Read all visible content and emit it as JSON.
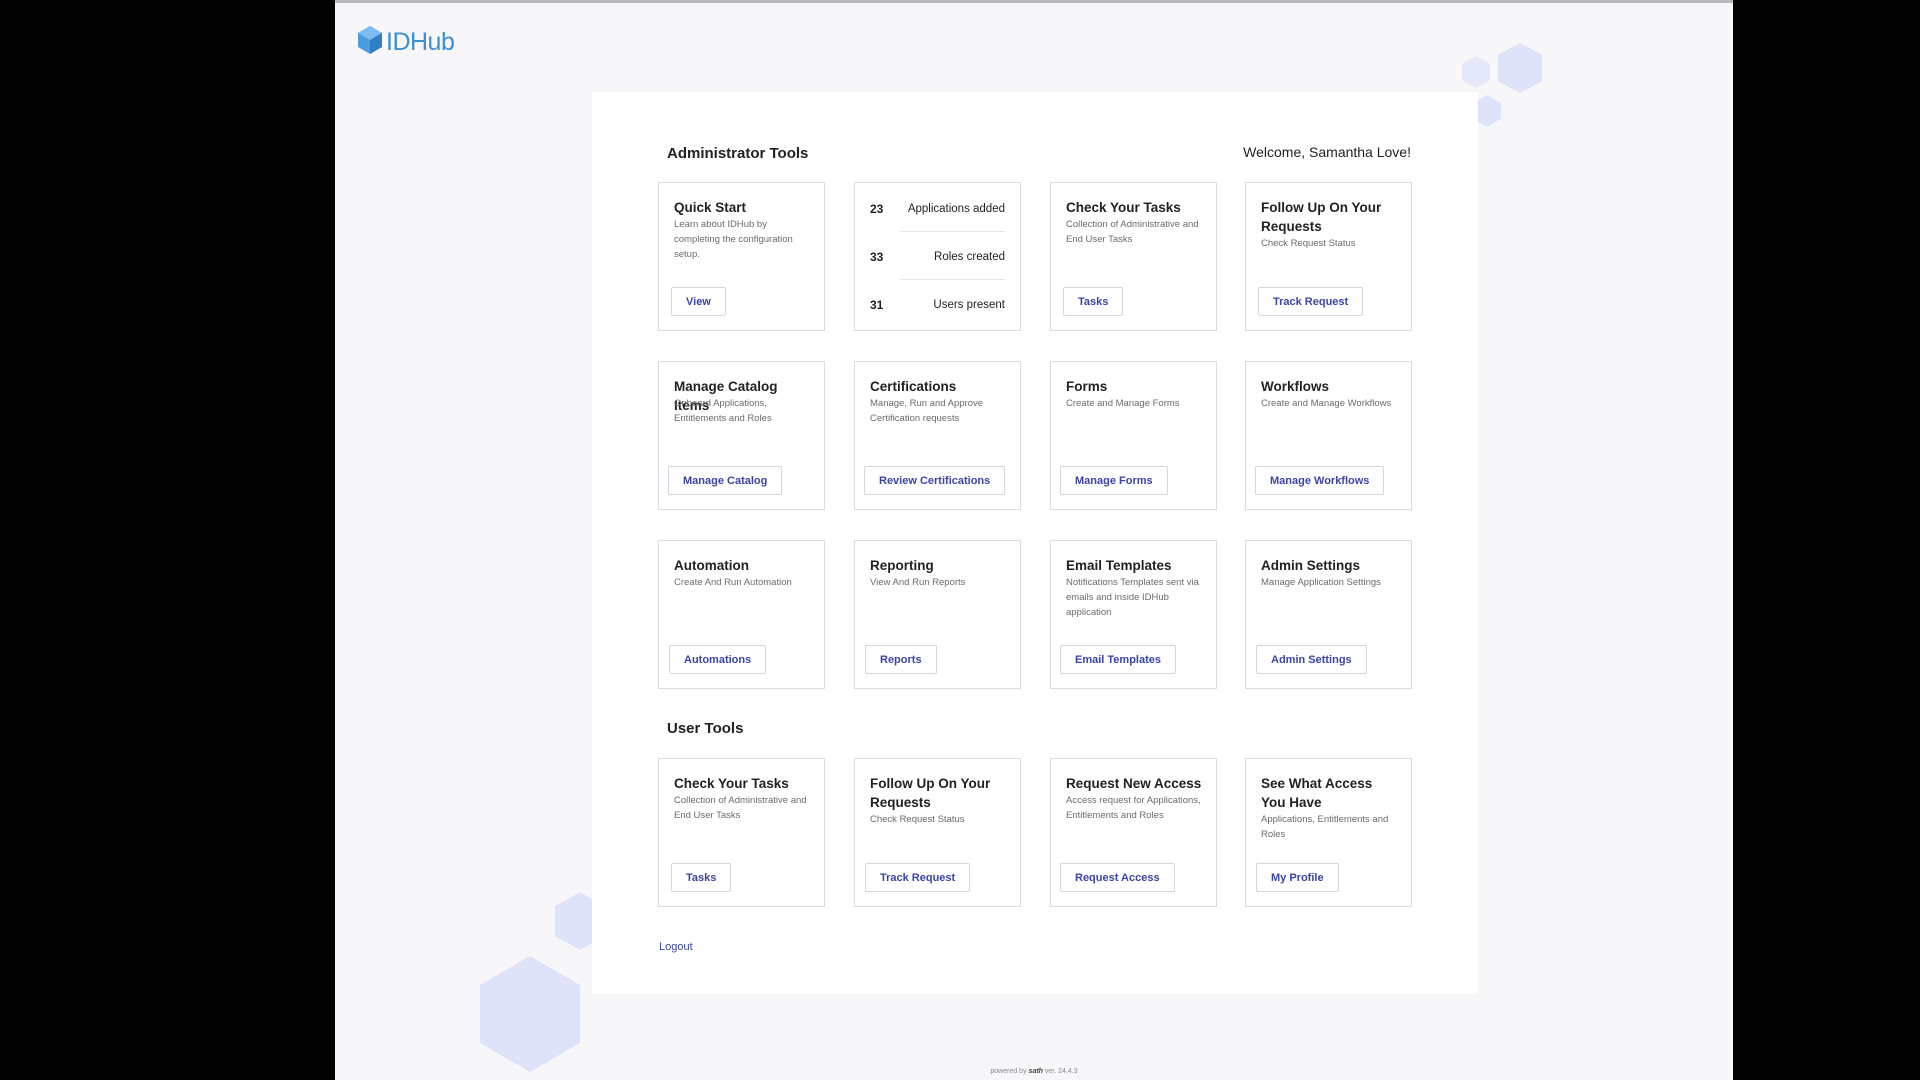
{
  "brand": {
    "logo_text": "IDHub",
    "logo_icon": "hexagon-logo-icon"
  },
  "admin_section_title": "Administrator Tools",
  "welcome_text": "Welcome, Samantha Love!",
  "stats": [
    {
      "value": "23",
      "label": "Applications added"
    },
    {
      "value": "33",
      "label": "Roles created"
    },
    {
      "value": "31",
      "label": "Users present"
    }
  ],
  "admin_cards": [
    {
      "title": "Quick Start",
      "desc": "Learn about IDHub by completing the configuration setup.",
      "button": "View"
    },
    {
      "title": "Check Your Tasks",
      "desc": "Collection of Administrative and End User Tasks",
      "button": "Tasks"
    },
    {
      "title": "Follow Up On Your Requests",
      "desc": "Check Request Status",
      "button": "Track Request"
    },
    {
      "title": "Manage Catalog Items",
      "desc": "Onboard Applications, Entitlements and Roles",
      "button": "Manage Catalog"
    },
    {
      "title": "Certifications",
      "desc": "Manage, Run and Approve Certification requests",
      "button": "Review Certifications"
    },
    {
      "title": "Forms",
      "desc": "Create and Manage Forms",
      "button": "Manage Forms"
    },
    {
      "title": "Workflows",
      "desc": "Create and Manage Workflows",
      "button": "Manage Workflows"
    },
    {
      "title": "Automation",
      "desc": "Create And Run Automation",
      "button": "Automations"
    },
    {
      "title": "Reporting",
      "desc": "View And Run Reports",
      "button": "Reports"
    },
    {
      "title": "Email Templates",
      "desc": "Notifications Templates sent via emails and inside IDHub application",
      "button": "Email Templates"
    },
    {
      "title": "Admin Settings",
      "desc": "Manage Application Settings",
      "button": "Admin Settings"
    }
  ],
  "user_section_title": "User Tools",
  "user_cards": [
    {
      "title": "Check Your Tasks",
      "desc": "Collection of Administrative and End User Tasks",
      "button": "Tasks"
    },
    {
      "title": "Follow Up On Your Requests",
      "desc": "Check Request Status",
      "button": "Track Request"
    },
    {
      "title": "Request New Access",
      "desc": "Access request for Applications, Entitlements and Roles",
      "button": "Request Access"
    },
    {
      "title": "See What Access You Have",
      "desc": "Applications, Entitlements and Roles",
      "button": "My Profile"
    }
  ],
  "logout_label": "Logout",
  "footer": {
    "powered": "powered by",
    "brand": "sath",
    "version": "ver. 24.4.3"
  },
  "colors": {
    "accent": "#3b45a5",
    "logo": "#3d8fd4",
    "decor_hex": "#dfe3fa",
    "background": "#f7f7f9"
  }
}
